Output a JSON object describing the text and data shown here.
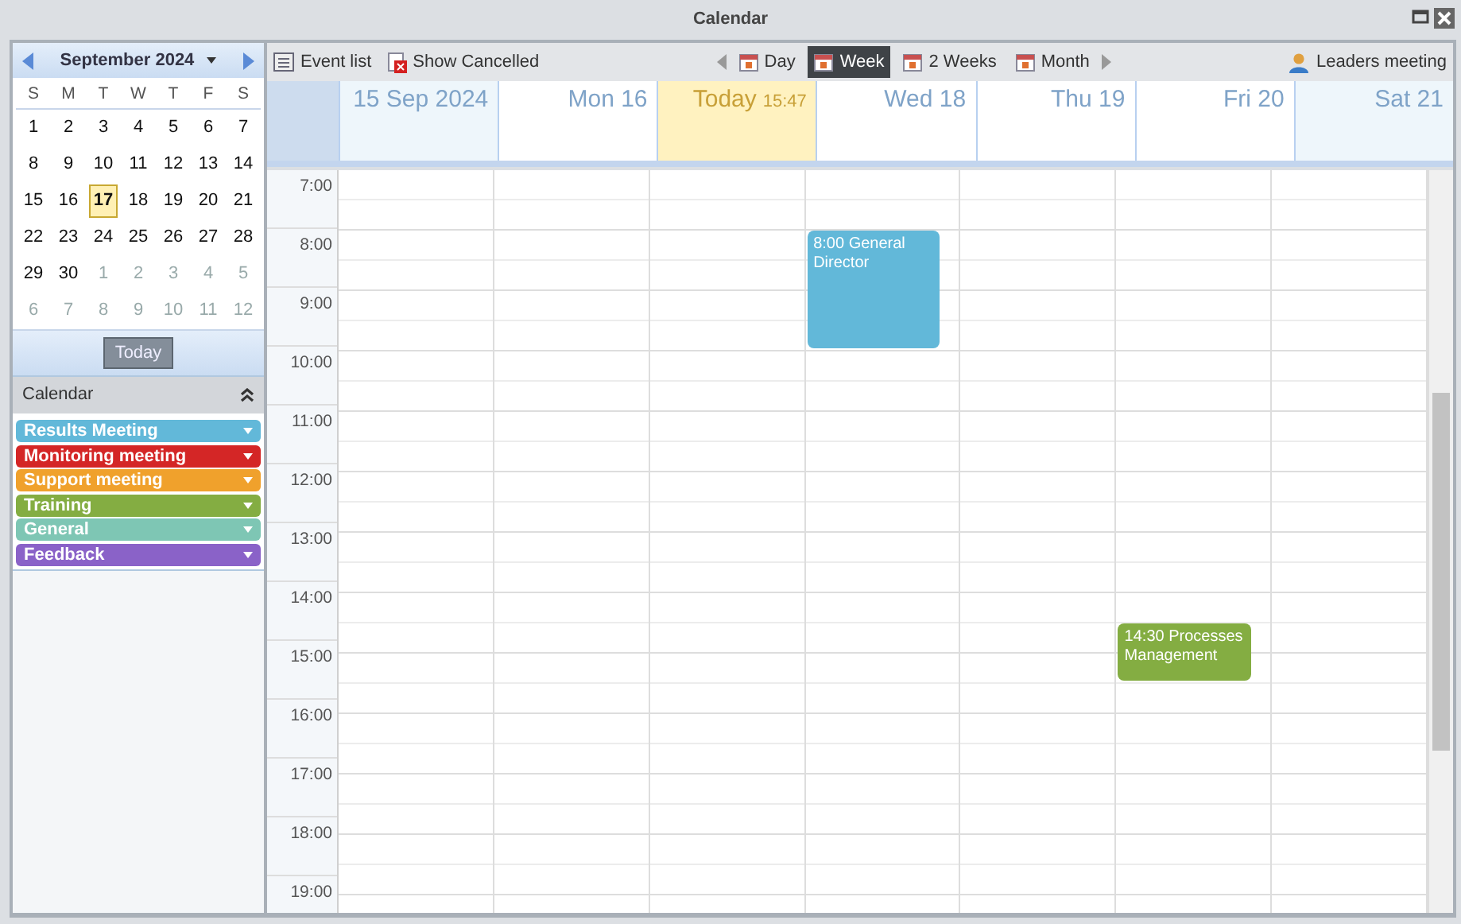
{
  "window": {
    "title": "Calendar"
  },
  "mini_calendar": {
    "month": "September 2024",
    "weekdays": [
      "S",
      "M",
      "T",
      "W",
      "T",
      "F",
      "S"
    ],
    "weeks": [
      [
        {
          "d": "1",
          "in_month": true,
          "selected": false
        },
        {
          "d": "2",
          "in_month": true,
          "selected": false
        },
        {
          "d": "3",
          "in_month": true,
          "selected": false
        },
        {
          "d": "4",
          "in_month": true,
          "selected": false
        },
        {
          "d": "5",
          "in_month": true,
          "selected": false
        },
        {
          "d": "6",
          "in_month": true,
          "selected": false
        },
        {
          "d": "7",
          "in_month": true,
          "selected": false
        }
      ],
      [
        {
          "d": "8",
          "in_month": true,
          "selected": false
        },
        {
          "d": "9",
          "in_month": true,
          "selected": false
        },
        {
          "d": "10",
          "in_month": true,
          "selected": false
        },
        {
          "d": "11",
          "in_month": true,
          "selected": false
        },
        {
          "d": "12",
          "in_month": true,
          "selected": false
        },
        {
          "d": "13",
          "in_month": true,
          "selected": false
        },
        {
          "d": "14",
          "in_month": true,
          "selected": false
        }
      ],
      [
        {
          "d": "15",
          "in_month": true,
          "selected": false
        },
        {
          "d": "16",
          "in_month": true,
          "selected": false
        },
        {
          "d": "17",
          "in_month": true,
          "selected": true
        },
        {
          "d": "18",
          "in_month": true,
          "selected": false
        },
        {
          "d": "19",
          "in_month": true,
          "selected": false
        },
        {
          "d": "20",
          "in_month": true,
          "selected": false
        },
        {
          "d": "21",
          "in_month": true,
          "selected": false
        }
      ],
      [
        {
          "d": "22",
          "in_month": true,
          "selected": false
        },
        {
          "d": "23",
          "in_month": true,
          "selected": false
        },
        {
          "d": "24",
          "in_month": true,
          "selected": false
        },
        {
          "d": "25",
          "in_month": true,
          "selected": false
        },
        {
          "d": "26",
          "in_month": true,
          "selected": false
        },
        {
          "d": "27",
          "in_month": true,
          "selected": false
        },
        {
          "d": "28",
          "in_month": true,
          "selected": false
        }
      ],
      [
        {
          "d": "29",
          "in_month": true,
          "selected": false
        },
        {
          "d": "30",
          "in_month": true,
          "selected": false
        },
        {
          "d": "1",
          "in_month": false,
          "selected": false
        },
        {
          "d": "2",
          "in_month": false,
          "selected": false
        },
        {
          "d": "3",
          "in_month": false,
          "selected": false
        },
        {
          "d": "4",
          "in_month": false,
          "selected": false
        },
        {
          "d": "5",
          "in_month": false,
          "selected": false
        }
      ],
      [
        {
          "d": "6",
          "in_month": false,
          "selected": false
        },
        {
          "d": "7",
          "in_month": false,
          "selected": false
        },
        {
          "d": "8",
          "in_month": false,
          "selected": false
        },
        {
          "d": "9",
          "in_month": false,
          "selected": false
        },
        {
          "d": "10",
          "in_month": false,
          "selected": false
        },
        {
          "d": "11",
          "in_month": false,
          "selected": false
        },
        {
          "d": "12",
          "in_month": false,
          "selected": false
        }
      ]
    ],
    "today_button": "Today"
  },
  "calendars": {
    "title": "Calendar",
    "items": [
      {
        "label": "Results Meeting",
        "color": "#62b8d9"
      },
      {
        "label": "Monitoring meeting",
        "color": "#d42626"
      },
      {
        "label": "Support meeting",
        "color": "#f0a12c"
      },
      {
        "label": "Training",
        "color": "#84ad42"
      },
      {
        "label": "General",
        "color": "#7ec6b4"
      },
      {
        "label": "Feedback",
        "color": "#8a62c8"
      }
    ]
  },
  "toolbar": {
    "event_list": "Event list",
    "show_cancelled": "Show Cancelled",
    "views": [
      {
        "label": "Day",
        "selected": false
      },
      {
        "label": "Week",
        "selected": true
      },
      {
        "label": "2 Weeks",
        "selected": false
      },
      {
        "label": "Month",
        "selected": false
      }
    ],
    "user": "Leaders meeting"
  },
  "days": [
    {
      "label": "15 Sep 2024",
      "weekend": true,
      "today": false
    },
    {
      "label": "Mon 16",
      "weekend": false,
      "today": false
    },
    {
      "label": "Today",
      "time": "15:47",
      "weekend": false,
      "today": true
    },
    {
      "label": "Wed 18",
      "weekend": false,
      "today": false,
      "events": [
        {
          "time": "8:00",
          "title": "General Director",
          "kind": "long",
          "color": "#62b8d9"
        }
      ]
    },
    {
      "label": "Thu 19",
      "weekend": false,
      "today": false
    },
    {
      "label": "Fri 20",
      "weekend": false,
      "today": false,
      "events": [
        {
          "time": "14:30",
          "title": "Processes Management",
          "kind": "short",
          "color": "#84ad42"
        }
      ]
    },
    {
      "label": "Sat 21",
      "weekend": true,
      "today": false
    }
  ],
  "hours": [
    "7:00",
    "8:00",
    "9:00",
    "10:00",
    "11:00",
    "12:00",
    "13:00",
    "14:00",
    "15:00",
    "16:00",
    "17:00",
    "18:00",
    "19:00"
  ]
}
